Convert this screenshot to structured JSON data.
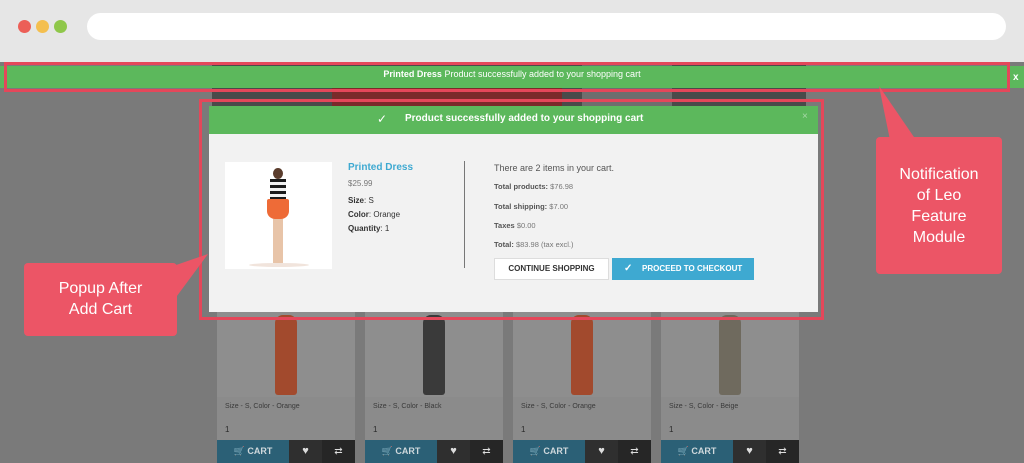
{
  "notification": {
    "product_name": "Printed Dress",
    "message": "Product successfully added to your shopping cart",
    "close_label": "x"
  },
  "popup": {
    "header": "Product successfully added to your shopping cart",
    "close_label": "×",
    "product": {
      "name": "Printed Dress",
      "price": "$25.99",
      "size_label": "Size",
      "size_value": "S",
      "color_label": "Color",
      "color_value": "Orange",
      "quantity_label": "Quantity",
      "quantity_value": "1"
    },
    "summary": {
      "items_text": "There are 2 items in your cart.",
      "total_products_label": "Total products:",
      "total_products_value": "$76.98",
      "total_shipping_label": "Total shipping:",
      "total_shipping_value": "$7.00",
      "taxes_label": "Taxes",
      "taxes_value": "$0.00",
      "total_label": "Total:",
      "total_value": "$83.98 (tax excl.)"
    },
    "continue_label": "CONTINUE SHOPPING",
    "checkout_label": "PROCEED TO CHECKOUT"
  },
  "products": [
    {
      "option": "Size - S, Color - Orange",
      "qty": "1",
      "cart_label": "CART"
    },
    {
      "option": "Size - S, Color - Black",
      "qty": "1",
      "cart_label": "CART"
    },
    {
      "option": "Size - S, Color - Orange",
      "qty": "1",
      "cart_label": "CART"
    },
    {
      "option": "Size - S, Color - Beige",
      "qty": "1",
      "cart_label": "CART"
    }
  ],
  "callouts": {
    "left": [
      "Popup After",
      "Add Cart"
    ],
    "right": [
      "Notification",
      "of Leo",
      "Feature",
      "Module"
    ]
  },
  "colors": {
    "success_green": "#5cb85c",
    "accent_blue": "#3ea9d1",
    "callout_red": "#ec5566"
  }
}
